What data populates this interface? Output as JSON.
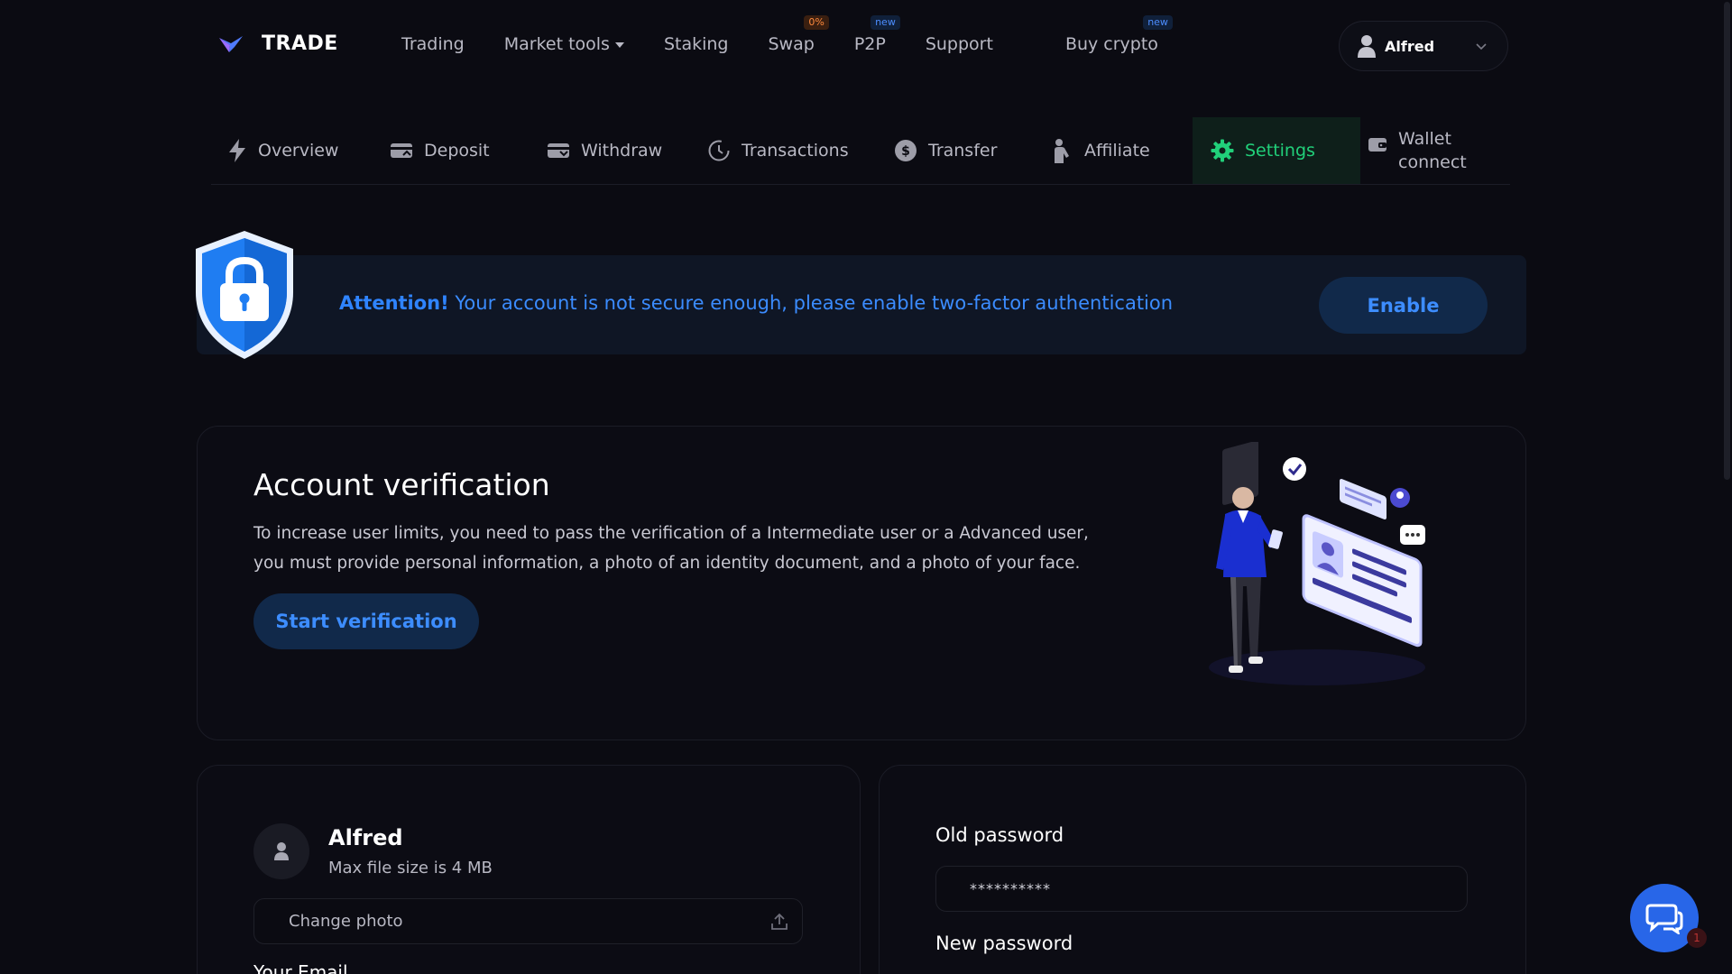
{
  "header": {
    "brand": "TRADE",
    "nav": [
      {
        "label": "Trading",
        "badge": ""
      },
      {
        "label": "Market tools",
        "badge": "",
        "dropdown": true
      },
      {
        "label": "Staking",
        "badge": ""
      },
      {
        "label": "Swap",
        "badge": "0%"
      },
      {
        "label": "P2P",
        "badge": "new"
      },
      {
        "label": "Support",
        "badge": ""
      },
      {
        "label": "Buy crypto",
        "badge": "new"
      }
    ],
    "user": "Alfred"
  },
  "tabs": [
    {
      "label": "Overview",
      "icon": "lightning-icon"
    },
    {
      "label": "Deposit",
      "icon": "card-deposit-icon"
    },
    {
      "label": "Withdraw",
      "icon": "card-withdraw-icon"
    },
    {
      "label": "Transactions",
      "icon": "history-icon"
    },
    {
      "label": "Transfer",
      "icon": "dollar-circle-icon"
    },
    {
      "label": "Affiliate",
      "icon": "person-icon"
    },
    {
      "label": "Settings",
      "icon": "gear-icon",
      "active": true
    },
    {
      "label": "Wallet connect",
      "label_line1": "Wallet",
      "label_line2": "connect",
      "icon": "wallet-icon"
    }
  ],
  "attention": {
    "strong": "Attention!",
    "message": " Your account is not secure enough, please enable two-factor authentication",
    "button": "Enable"
  },
  "verification": {
    "title": "Account verification",
    "description": "To increase user limits, you need to pass the verification of a Intermediate user or a Advanced user, you must provide personal information, a photo of an identity document, and a photo of your face.",
    "button": "Start verification"
  },
  "profile": {
    "name": "Alfred",
    "hint": "Max file size is 4 MB",
    "photo_field": "Change photo",
    "email_label": "Your Email"
  },
  "password": {
    "old_label": "Old password",
    "old_value": "**********",
    "new_label": "New password"
  },
  "chat": {
    "unread": "1"
  },
  "colors": {
    "background": "#0b0b12",
    "accent_green": "#21d07a",
    "accent_blue": "#3d8dff",
    "chat_blue": "#2866e8"
  }
}
